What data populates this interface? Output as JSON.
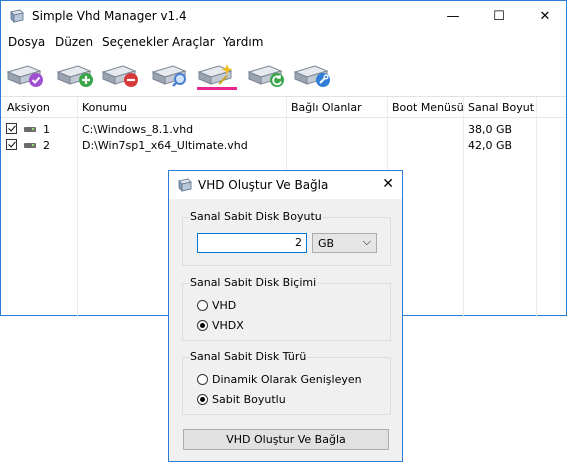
{
  "window": {
    "title": "Simple Vhd Manager v1.4",
    "controls": {
      "minimize": "—",
      "maximize": "☐",
      "close": "✕"
    }
  },
  "menu": [
    "Dosya",
    "Düzen",
    "Seçenekler",
    "Araçlar",
    "Yardım"
  ],
  "toolbar": {
    "buttons": [
      {
        "name": "attach-vhd",
        "icon": "drive-check-icon",
        "accent": "#a04fd1"
      },
      {
        "name": "add-vhd",
        "icon": "drive-plus-icon",
        "accent": "#3aa64a"
      },
      {
        "name": "remove-vhd",
        "icon": "drive-minus-icon",
        "accent": "#d83a3a"
      },
      {
        "name": "vhd-properties",
        "icon": "drive-magnifier-icon",
        "accent": "#4a7fd0"
      },
      {
        "name": "create-and-attach-vhd",
        "icon": "drive-sparkle-icon",
        "accent": "#f2c01a",
        "active": true
      },
      {
        "name": "refresh-vhd",
        "icon": "drive-refresh-icon",
        "accent": "#35a548"
      },
      {
        "name": "tools-vhd",
        "icon": "drive-wrench-icon",
        "accent": "#2f7ed8"
      }
    ],
    "active_underline_color": "#e8248f"
  },
  "table": {
    "columns": [
      "Aksiyon",
      "Konumu",
      "Bağlı Olanlar",
      "Boot Menüsü",
      "Sanal Boyut"
    ],
    "rows": [
      {
        "checked": true,
        "index": "1",
        "path": "C:\\Windows_8.1.vhd",
        "attached": "",
        "boot": "",
        "size": "38,0 GB"
      },
      {
        "checked": true,
        "index": "2",
        "path": "D:\\Win7sp1_x64_Ultimate.vhd",
        "attached": "",
        "boot": "",
        "size": "42,0 GB"
      }
    ]
  },
  "dialog": {
    "title": "VHD Oluştur Ve Bağla",
    "close": "✕",
    "size_group": {
      "label": "Sanal Sabit Disk Boyutu",
      "value": "2",
      "unit": "GB",
      "unit_arrow": "⌵"
    },
    "format_group": {
      "label": "Sanal Sabit Disk Biçimi",
      "options": [
        {
          "label": "VHD",
          "selected": false
        },
        {
          "label": "VHDX",
          "selected": true
        }
      ]
    },
    "type_group": {
      "label": "Sanal Sabit Disk Türü",
      "options": [
        {
          "label": "Dinamik Olarak Genişleyen",
          "selected": false
        },
        {
          "label": "Sabit Boyutlu",
          "selected": true
        }
      ]
    },
    "submit_label": "VHD Oluştur Ve Bağla"
  }
}
